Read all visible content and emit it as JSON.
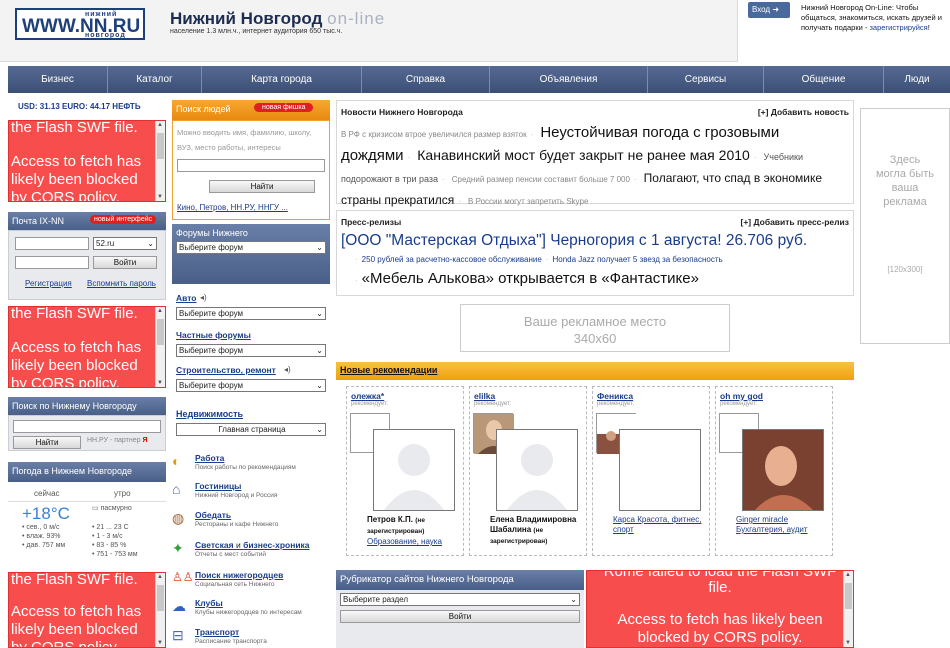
{
  "header": {
    "logo_top": "нижний",
    "logo_main": "WWW.NN.RU",
    "logo_bottom": "новгород",
    "title": "Нижний Новгород",
    "title_suffix": "on-line",
    "subtitle": "население 1.3 млн.ч., интернет аудитория 650 тыс.ч.",
    "login_button": "Вход ➜",
    "login_text": "Нижний Новгород On-Line: Чтобы общаться, знакомиться, искать друзей и получать подарки - ",
    "register_link": "зарегистрируйся",
    "register_suffix": "!"
  },
  "nav": [
    "Бизнес",
    "Каталог",
    "Карта города",
    "Справка",
    "Объявления",
    "Сервисы",
    "Общение",
    "Люди"
  ],
  "currency": {
    "usd": "USD: 31.13",
    "euro": "EURO: 44.17",
    "oil": "НЕФТЬ"
  },
  "flash": {
    "line1": "the Flash SWF file.",
    "line2": "Access to fetch has",
    "line3": "likely been blocked",
    "line4": "by CORS policy.",
    "big_line1": "Rome failed to load the Flash SWF",
    "big_line2": "file.",
    "big_line3": "Access to fetch has likely been",
    "big_line4": "blocked by CORS policy."
  },
  "mail": {
    "title": "Почта IX-NN",
    "badge": "новый интерфейс",
    "domain": "52.ru",
    "login_button": "Войти",
    "register": "Регистрация",
    "forgot": "Вспомнить пароль"
  },
  "search": {
    "title": "Поиск по Нижнему Новгороду",
    "button": "Найти",
    "partner": "НН.РУ - партнер ",
    "partner_brand": "Я"
  },
  "weather": {
    "title": "Погода в Нижнем Новгороде",
    "now_label": "сейчас",
    "morning_label": "утро",
    "temp": "+18°C",
    "wind": "сев., 0 м/с",
    "humidity": "влаж. 93%",
    "pressure": "дав. 757 мм",
    "icon_alt": "пасмурно",
    "m_temp": "21 ... 23 C",
    "m_wind": "1 - 3 м/с",
    "m_hum": "83 - 85 %",
    "m_press": "751 - 753 мм"
  },
  "people": {
    "title": "Поиск людей",
    "badge": "новая фишка",
    "hint": "Можно вводить имя, фамилию, школу, ВУЗ, место работы, интересы",
    "button": "Найти",
    "links": "Кино, Петров, НН.РУ, ННГУ ..."
  },
  "forums": {
    "title": "Форумы Нижнего",
    "select": "Выберите форум",
    "sections": [
      {
        "label": "Авто",
        "select": "Выберите форум"
      },
      {
        "label": "Частные форумы",
        "select": "Выберите форум"
      },
      {
        "label": "Строительство, ремонт",
        "select": "Выберите форум"
      },
      {
        "label": "Недвижимость",
        "select": "Главная страница"
      }
    ]
  },
  "services": [
    {
      "title": "Работа",
      "desc": "Поиск работы по рекомендациям"
    },
    {
      "title": "Гостиницы",
      "desc": "Нижний Новгород и Россия"
    },
    {
      "title": "Обедать",
      "desc": "Рестораны и кафе Нижнего"
    },
    {
      "title": "Светская",
      "title2": "бизнес-хроника",
      "joiner": " и ",
      "desc": "Отчеты с мест событий"
    },
    {
      "title": "Поиск нижегородцев",
      "desc": "Социальная сеть Нижнего"
    },
    {
      "title": "Клубы",
      "desc": "Клубы нижегородцев по интересам"
    },
    {
      "title": "Транспорт",
      "desc": "Расписание транспорта"
    }
  ],
  "news": {
    "title": "Новости Нижнего Новгорода",
    "add": "[+] Добавить новость",
    "items": [
      "В РФ с кризисом втрое увеличился размер взяток",
      "Неустойчивая погода с грозовыми дождями",
      "Канавинский мост будет закрыт не ранее мая 2010",
      "Учебники подорожают в три раза",
      "Средний размер пенсии составит больше 7 000",
      "Полагают, что спад в экономике страны прекратился",
      "В России могут запретить Skype"
    ]
  },
  "press": {
    "title": "Пресс-релизы",
    "add": "[+] Добавить пресс-релиз",
    "items": [
      "[ООО \"Мастерская Отдыха\"] Черногория с 1 августа! 26.706 руб.",
      "250 рублей за расчетно-кассовое обслуживание",
      "Honda Jazz получает 5 звезд за безопасность",
      "«Мебель Алькова» открывается в «Фантастике»"
    ]
  },
  "ad": {
    "line1": "Ваше рекламное место",
    "line2": "340x60"
  },
  "right_ad": {
    "line1": "Здесь",
    "line2": "могла быть",
    "line3": "ваша",
    "line4": "реклама",
    "size": "[120x300]"
  },
  "recommendations": {
    "title": "Новые рекомендации",
    "recommends": "рекомендует:",
    "items": [
      {
        "user": "олежка*",
        "name": "Петров К.П.",
        "note": "(не зарегистрирован)",
        "sub": "Образование, наука"
      },
      {
        "user": "elilka",
        "name": "Елена Владимировна Шабалина",
        "note": "(не зарегистрирован)",
        "sub": ""
      },
      {
        "user": "Феникса",
        "name": "",
        "note": "",
        "sub": "Карса Красота, фитнес, спорт"
      },
      {
        "user": "oh my god",
        "name": "",
        "note": "",
        "sub": "Ginger miracle Бухгалтерия, аудит"
      }
    ]
  },
  "rubricator": {
    "title": "Рубрикатор сайтов Нижнего Новгорода",
    "select": "Выберите раздел",
    "button": "Войти"
  }
}
